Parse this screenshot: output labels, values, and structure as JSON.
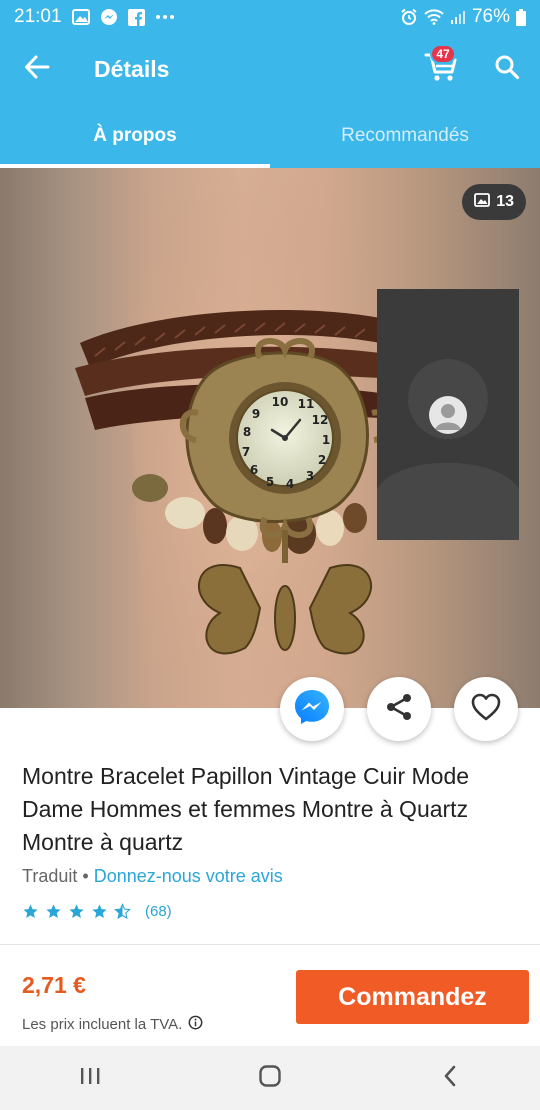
{
  "status_bar": {
    "time": "21:01",
    "battery": "76%",
    "icons": [
      "image-notification-icon",
      "messenger-notification-icon",
      "facebook-notification-icon",
      "more-notifications-icon",
      "alarm-icon",
      "wifi-icon",
      "signal-icon",
      "battery-icon"
    ]
  },
  "app_bar": {
    "back_icon": "arrow-back-icon",
    "title": "Détails",
    "cart_icon": "cart-icon",
    "cart_count": "47",
    "search_icon": "search-icon"
  },
  "tabs": [
    {
      "label": "À propos",
      "active": true
    },
    {
      "label": "Recommandés",
      "active": false
    }
  ],
  "gallery": {
    "photo_count": "13",
    "photo_count_icon": "image-icon"
  },
  "actions": {
    "messenger_icon": "messenger-icon",
    "share_icon": "share-icon",
    "favorite_icon": "heart-icon"
  },
  "product": {
    "title": "Montre Bracelet Papillon Vintage Cuir Mode Dame Hommes et femmes Montre à Quartz Montre à quartz",
    "translated_label": "Traduit",
    "separator": "•",
    "feedback_link": "Donnez-nous votre avis",
    "rating": 4.5,
    "rating_max": 5,
    "rating_count": "(68)",
    "price": "2,71 €",
    "vat_note": "Les prix incluent la TVA.",
    "info_icon": "info-icon",
    "order_button": "Commandez"
  },
  "nav_bar": {
    "icons": [
      "recent-apps-icon",
      "home-icon",
      "back-nav-icon"
    ]
  },
  "colors": {
    "primary": "#3bb7ea",
    "accent": "#f15c26",
    "price": "#e55a1f",
    "link": "#2aa6d8",
    "badge": "#e8344a"
  }
}
